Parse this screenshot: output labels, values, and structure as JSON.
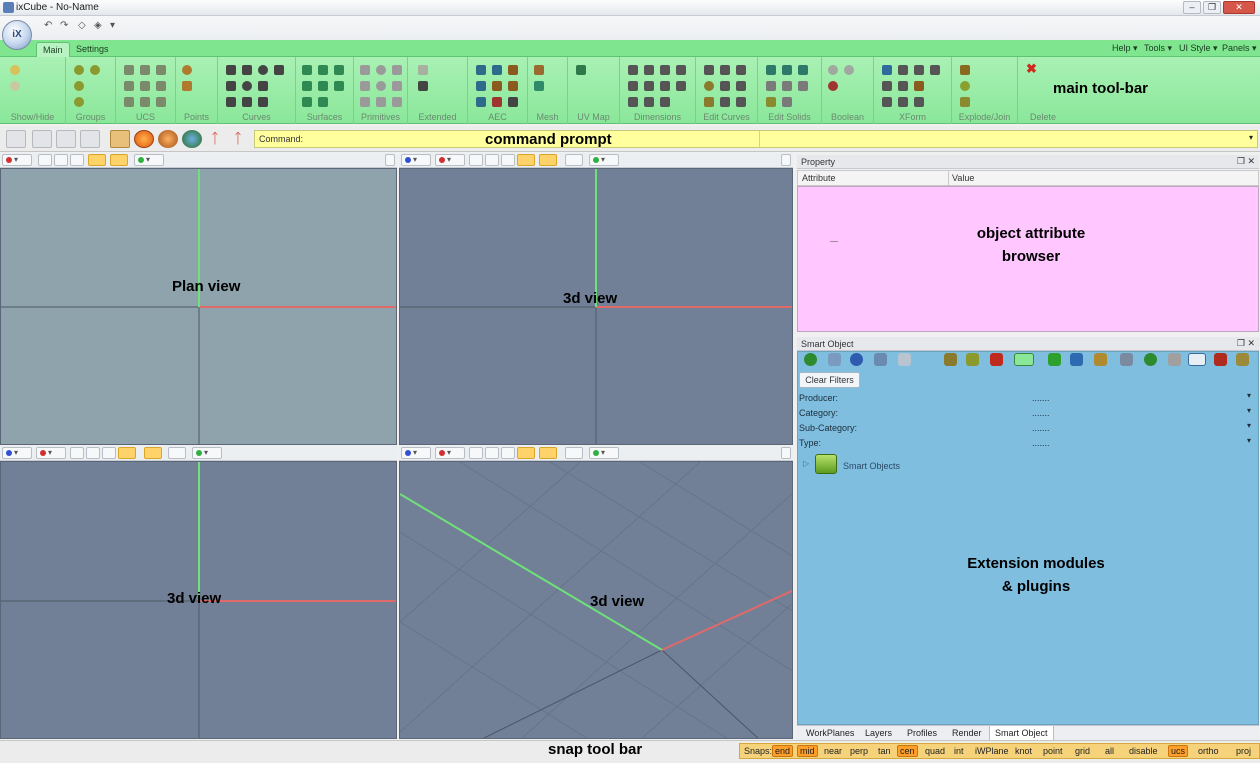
{
  "window": {
    "title": "ixCube - No-Name",
    "app_orb": "iX"
  },
  "ribbon": {
    "tabs": [
      "Main",
      "Settings"
    ],
    "right_menus": [
      "Help",
      "Tools",
      "UI Style",
      "Panels"
    ],
    "groups": [
      "Show/Hide",
      "Groups",
      "UCS",
      "Points",
      "Curves",
      "Surfaces",
      "Primitives",
      "Extended",
      "AEC",
      "Mesh",
      "UV Map",
      "Dimensions",
      "Edit Curves",
      "Edit Solids",
      "Boolean",
      "XForm",
      "Explode/Join",
      "Delete"
    ],
    "annotation": "main tool-bar"
  },
  "command": {
    "label": "Command:",
    "annotation": "command prompt"
  },
  "viewports": [
    {
      "label": "Plan view"
    },
    {
      "label": "3d view"
    },
    {
      "label": "3d view"
    },
    {
      "label": "3d view"
    }
  ],
  "property_panel": {
    "title": "Property",
    "columns": [
      "Attribute",
      "Value"
    ],
    "annotation_line1": "object attribute",
    "annotation_line2": "browser"
  },
  "smart_object_panel": {
    "title": "Smart Object",
    "clear_filters": "Clear Filters",
    "filters": [
      {
        "label": "Producer:",
        "value": "......."
      },
      {
        "label": "Category:",
        "value": "......."
      },
      {
        "label": "Sub-Category:",
        "value": "......."
      },
      {
        "label": "Type:",
        "value": "......."
      }
    ],
    "tree_root": "Smart Objects",
    "annotation_line1": "Extension modules",
    "annotation_line2": "& plugins",
    "tabs": [
      "WorkPlanes",
      "Layers",
      "Profiles",
      "Render",
      "Smart Object"
    ]
  },
  "status": {
    "annotation": "snap tool bar",
    "snaps_label": "Snaps:",
    "snaps": [
      {
        "name": "end",
        "on": true
      },
      {
        "name": "mid",
        "on": true
      },
      {
        "name": "near",
        "on": false
      },
      {
        "name": "perp",
        "on": false
      },
      {
        "name": "tan",
        "on": false
      },
      {
        "name": "cen",
        "on": true
      },
      {
        "name": "quad",
        "on": false
      },
      {
        "name": "int",
        "on": false
      },
      {
        "name": "iWPlane",
        "on": false
      },
      {
        "name": "knot",
        "on": false
      },
      {
        "name": "point",
        "on": false
      },
      {
        "name": "grid",
        "on": false
      },
      {
        "name": "all",
        "on": false
      },
      {
        "name": "disable",
        "on": false
      },
      {
        "name": "ucs",
        "on": true
      },
      {
        "name": "ortho",
        "on": false
      },
      {
        "name": "proj",
        "on": false
      }
    ]
  },
  "colors": {
    "ribbon": "#8ae79a",
    "command_field": "#ffff9e",
    "property_bg": "#ffc6ff",
    "smart_bg": "#7fbedf",
    "viewport_bg": "#718097",
    "x_axis": "#e06a6a",
    "y_axis": "#6fe07a"
  }
}
